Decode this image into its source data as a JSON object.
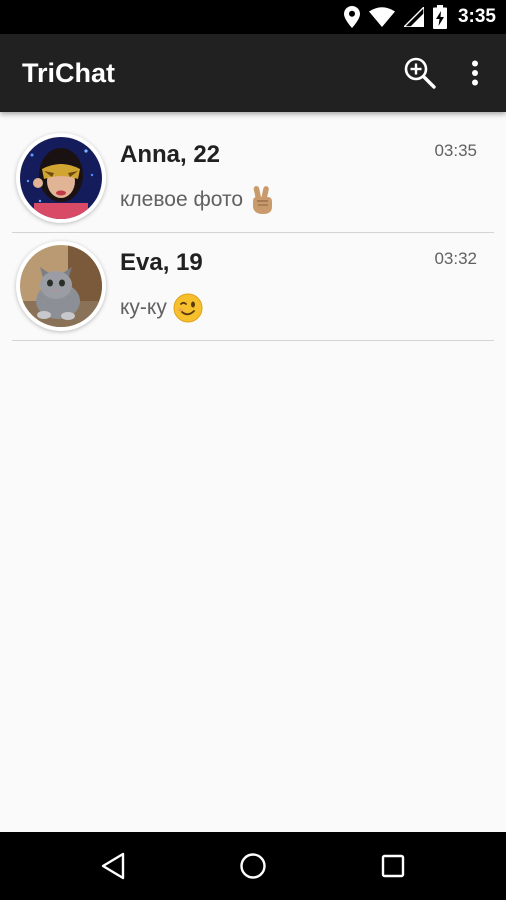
{
  "status_bar": {
    "time": "3:35",
    "icons": [
      "location-icon",
      "wifi-icon",
      "signal-icon",
      "battery-charging-icon"
    ]
  },
  "app_bar": {
    "title": "TriChat",
    "actions": [
      "zoom-in-search-icon",
      "more-vert-icon"
    ]
  },
  "chats": [
    {
      "name": "Anna, 22",
      "time": "03:35",
      "message": "клевое фото",
      "emoji": "victory-hand",
      "avatar": "woman-with-mask-photo"
    },
    {
      "name": "Eva, 19",
      "time": "03:32",
      "message": "ку-ку",
      "emoji": "winking-face",
      "avatar": "gray-kitten-photo"
    }
  ],
  "nav_bar": {
    "buttons": [
      "back-icon",
      "home-icon",
      "recents-icon"
    ]
  },
  "colors": {
    "app_bar": "#212121",
    "status_bar": "#000000",
    "background": "#fafafa",
    "divider": "#d4d4d4",
    "secondary_text": "#616161"
  }
}
